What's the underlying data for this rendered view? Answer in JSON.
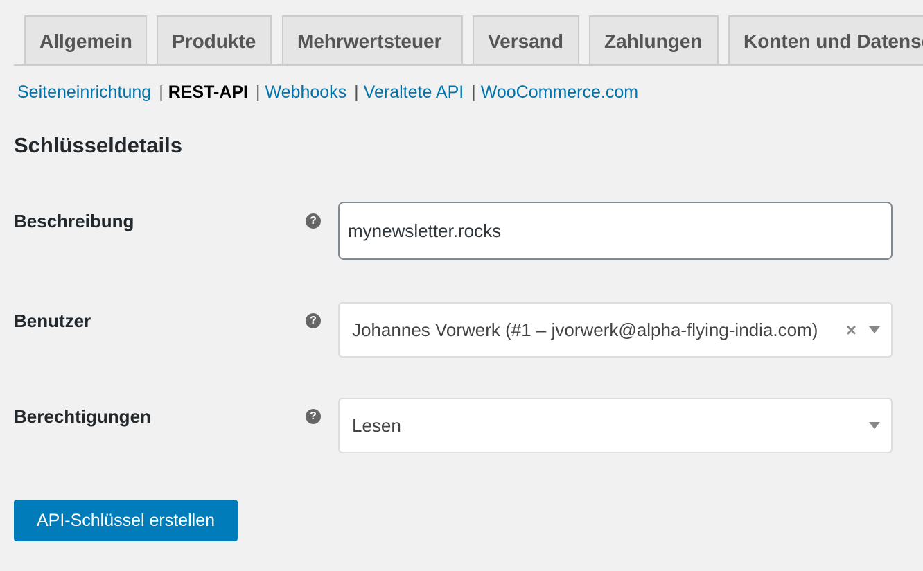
{
  "tabs": [
    {
      "label": "Allgemein"
    },
    {
      "label": "Produkte"
    },
    {
      "label": "Mehrwertsteuer"
    },
    {
      "label": "Versand"
    },
    {
      "label": "Zahlungen"
    },
    {
      "label": "Konten und Datenschutz"
    }
  ],
  "subnav": {
    "items": [
      {
        "label": "Seiteneinrichtung",
        "current": false
      },
      {
        "label": "REST-API",
        "current": true
      },
      {
        "label": "Webhooks",
        "current": false
      },
      {
        "label": "Veraltete API",
        "current": false
      },
      {
        "label": "WooCommerce.com",
        "current": false
      }
    ],
    "separator": "|"
  },
  "section_title": "Schlüsseldetails",
  "form": {
    "description": {
      "label": "Beschreibung",
      "help_icon": "?",
      "value": "mynewsletter.rocks"
    },
    "user": {
      "label": "Benutzer",
      "help_icon": "?",
      "value": "Johannes Vorwerk (#1 – jvorwerk@alpha-flying-india.com)",
      "clear_icon": "×"
    },
    "permissions": {
      "label": "Berechtigungen",
      "help_icon": "?",
      "value": "Lesen"
    }
  },
  "submit_label": "API-Schlüssel erstellen",
  "colors": {
    "link": "#0073aa",
    "primary": "#007cba",
    "background": "#f1f1f1"
  },
  "icons": {
    "help": "help-circle-icon",
    "clear": "close-icon",
    "dropdown": "chevron-down-icon"
  }
}
